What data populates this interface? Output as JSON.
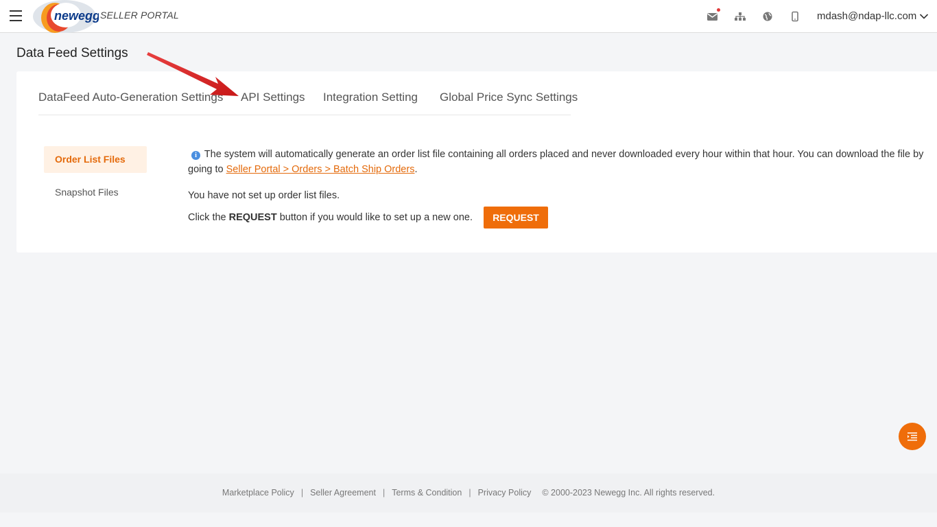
{
  "header": {
    "logo_text": "newegg",
    "portal_label": "SELLER PORTAL",
    "user_email": "mdash@ndap-llc.com",
    "icons": [
      "menu-icon",
      "mail-icon",
      "sitemap-icon",
      "globe-icon",
      "mobile-icon",
      "chevron-down-icon"
    ]
  },
  "page": {
    "title": "Data Feed Settings"
  },
  "tabs": [
    {
      "label": "DataFeed Auto-Generation Settings"
    },
    {
      "label": "API Settings"
    },
    {
      "label": "Integration Setting"
    },
    {
      "label": "Global Price Sync Settings"
    }
  ],
  "side_menu": [
    {
      "label": "Order List Files",
      "active": true
    },
    {
      "label": "Snapshot Files",
      "active": false
    }
  ],
  "content": {
    "info_text_1": "The system will automatically generate an order list file containing all orders placed and never downloaded every hour within that hour. You can download the file by",
    "info_text_2_prefix": "going to ",
    "info_link": "Seller Portal > Orders > Batch Ship Orders",
    "info_text_2_suffix": ".",
    "notice": "You have not set up order list files.",
    "request_prefix": "Click the ",
    "request_bold": "REQUEST",
    "request_suffix": " button if you would like to set up a new one.",
    "request_button": "REQUEST"
  },
  "footer": {
    "links": [
      "Marketplace Policy",
      "Seller Agreement",
      "Terms & Condition",
      "Privacy Policy"
    ],
    "separator": "|",
    "copyright": "© 2000-2023 Newegg Inc. All rights reserved."
  },
  "colors": {
    "accent": "#ef6d0a",
    "active_bg": "#fff1e4",
    "info_blue": "#4a8fe0",
    "annotation_arrow": "#e02020"
  }
}
